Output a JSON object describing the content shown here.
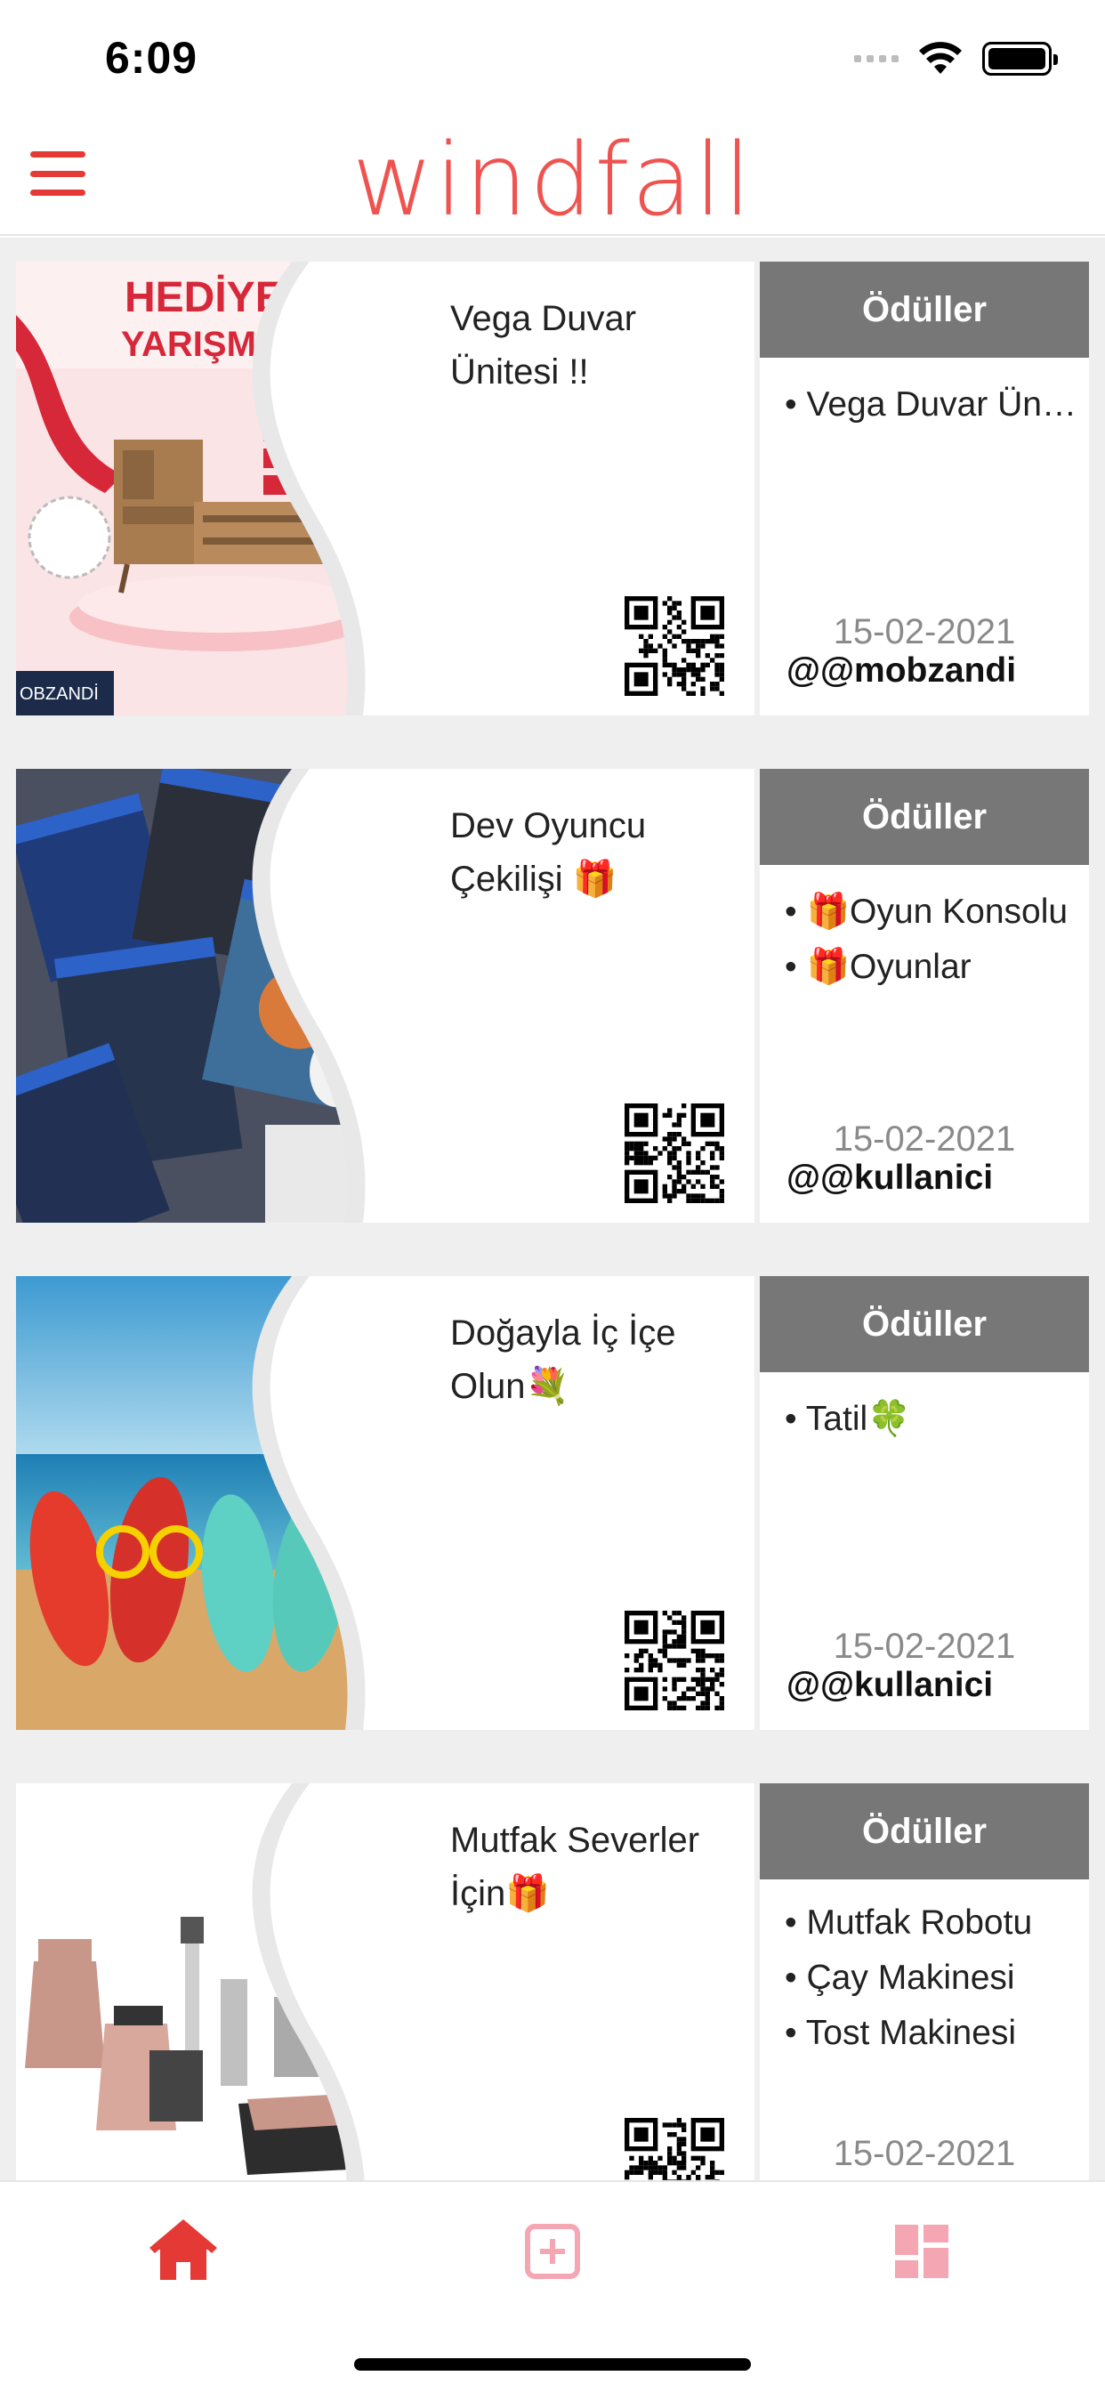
{
  "status_bar": {
    "time": "6:09"
  },
  "header": {
    "logo_text": "windfall"
  },
  "colors": {
    "brand": "#ef5350",
    "prize_header": "#777777"
  },
  "cards": [
    {
      "title": "Vega Duvar Ünitesi !!",
      "image": "hediye-yarismasi-furniture",
      "prizes_label": "Ödüller",
      "prizes": [
        "Vega Duvar Ünitesi"
      ],
      "date": "15-02-2021",
      "user": "@@mobzandi"
    },
    {
      "title": "Dev Oyuncu Çekilişi 🎁",
      "image": "ps4-games",
      "prizes_label": "Ödüller",
      "prizes": [
        "🎁Oyun Konsolu",
        "🎁Oyunlar"
      ],
      "date": "15-02-2021",
      "user": "@@kullanici"
    },
    {
      "title": "Doğayla İç İçe Olun💐",
      "image": "beach-flip-flops",
      "prizes_label": "Ödüller",
      "prizes": [
        "Tatil🍀"
      ],
      "date": "15-02-2021",
      "user": "@@kullanici"
    },
    {
      "title": "Mutfak Severler İçin🎁",
      "image": "kitchen-appliances",
      "prizes_label": "Ödüller",
      "prizes": [
        "Mutfak Robotu",
        "Çay Makinesi",
        "Tost Makinesi"
      ],
      "date": "15-02-2021",
      "user": ""
    }
  ],
  "tabs": [
    {
      "icon": "home-icon",
      "active": true
    },
    {
      "icon": "add-square-icon",
      "active": false
    },
    {
      "icon": "dashboard-icon",
      "active": false
    }
  ]
}
